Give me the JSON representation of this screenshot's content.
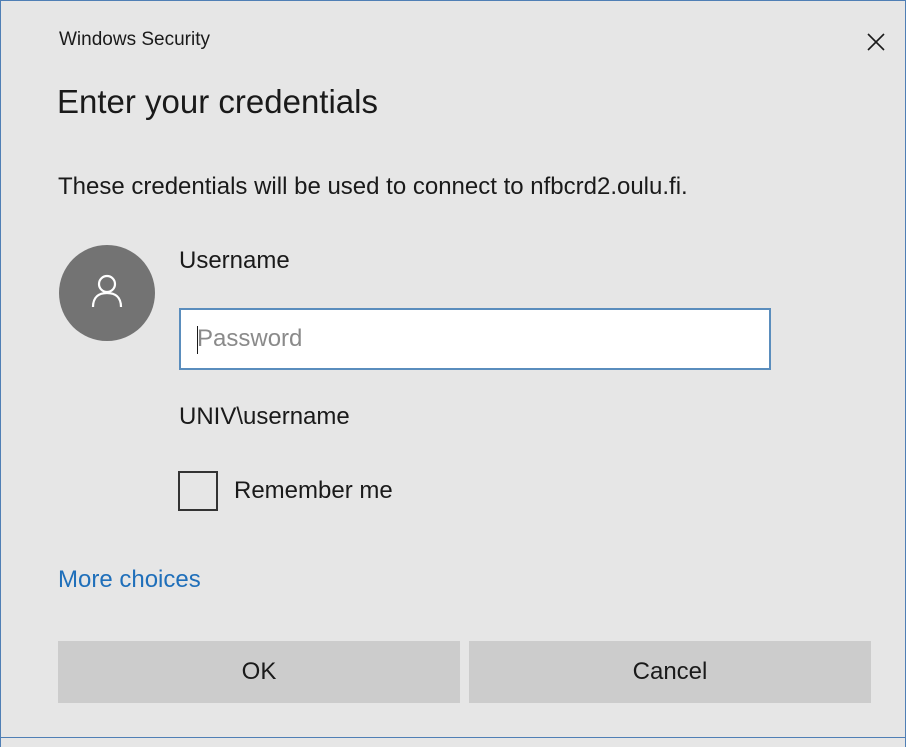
{
  "window": {
    "title": "Windows Security",
    "close_icon": "close-icon"
  },
  "dialog": {
    "heading": "Enter your credentials",
    "description": "These credentials will be used to connect to nfbcrd2.oulu.fi.",
    "avatar_icon": "user-icon",
    "username_label": "Username",
    "password_field": {
      "value": "",
      "placeholder": "Password"
    },
    "domain_label": "UNIV\\username",
    "remember_me": {
      "label": "Remember me",
      "checked": false
    },
    "more_choices_label": "More choices",
    "buttons": {
      "ok_label": "OK",
      "cancel_label": "Cancel"
    }
  },
  "colors": {
    "background": "#e6e6e6",
    "accent_border": "#4f7fb5",
    "link": "#1f6fba",
    "button_bg": "#cccccc",
    "avatar_bg": "#737373"
  }
}
